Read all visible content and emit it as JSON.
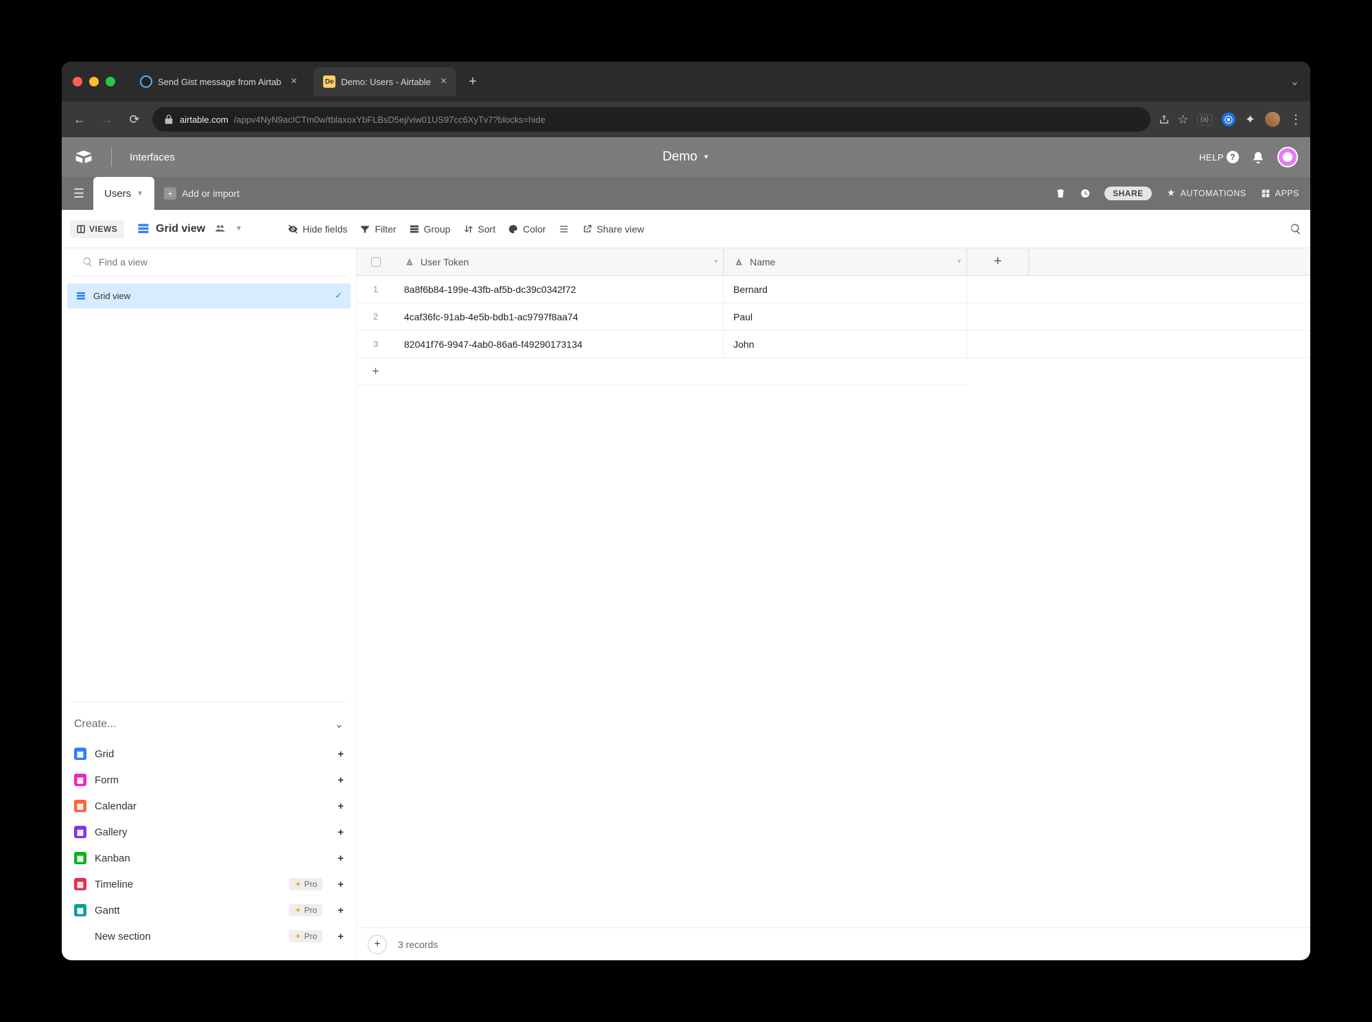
{
  "browser": {
    "tabs": [
      {
        "title": "Send Gist message from Airtab",
        "favicon": "gist",
        "active": false
      },
      {
        "title": "Demo: Users - Airtable",
        "favicon": "demo",
        "favicon_text": "De",
        "active": true
      }
    ],
    "url_host": "airtable.com",
    "url_path": "/appv4NyN9acICTm0w/tblaxoxYbFLBsD5ej/viw01US97cc6XyTv7?blocks=hide"
  },
  "appbar": {
    "interfaces": "Interfaces",
    "base_name": "Demo",
    "help_label": "HELP"
  },
  "tablebar": {
    "table_name": "Users",
    "add_or_import": "Add or import",
    "share": "SHARE",
    "automations": "AUTOMATIONS",
    "apps": "APPS"
  },
  "viewbar": {
    "views_toggle": "VIEWS",
    "view_name": "Grid view",
    "hide_fields": "Hide fields",
    "filter": "Filter",
    "group": "Group",
    "sort": "Sort",
    "color": "Color",
    "share_view": "Share view"
  },
  "sidebar": {
    "find_placeholder": "Find a view",
    "selected_view": "Grid view",
    "create_label": "Create...",
    "items": [
      {
        "label": "Grid",
        "icon": "blue",
        "pro": false
      },
      {
        "label": "Form",
        "icon": "pink",
        "pro": false
      },
      {
        "label": "Calendar",
        "icon": "orange",
        "pro": false
      },
      {
        "label": "Gallery",
        "icon": "purple",
        "pro": false
      },
      {
        "label": "Kanban",
        "icon": "green",
        "pro": false
      },
      {
        "label": "Timeline",
        "icon": "red",
        "pro": true
      },
      {
        "label": "Gantt",
        "icon": "teal",
        "pro": true
      },
      {
        "label": "New section",
        "icon": "",
        "pro": true
      }
    ],
    "pro_label": "Pro"
  },
  "grid": {
    "columns": [
      {
        "label": "User Token"
      },
      {
        "label": "Name"
      }
    ],
    "rows": [
      {
        "num": "1",
        "token": "8a8f6b84-199e-43fb-af5b-dc39c0342f72",
        "name": "Bernard"
      },
      {
        "num": "2",
        "token": "4caf36fc-91ab-4e5b-bdb1-ac9797f8aa74",
        "name": "Paul"
      },
      {
        "num": "3",
        "token": "82041f76-9947-4ab0-86a6-f49290173134",
        "name": "John"
      }
    ],
    "footer_count": "3 records"
  }
}
